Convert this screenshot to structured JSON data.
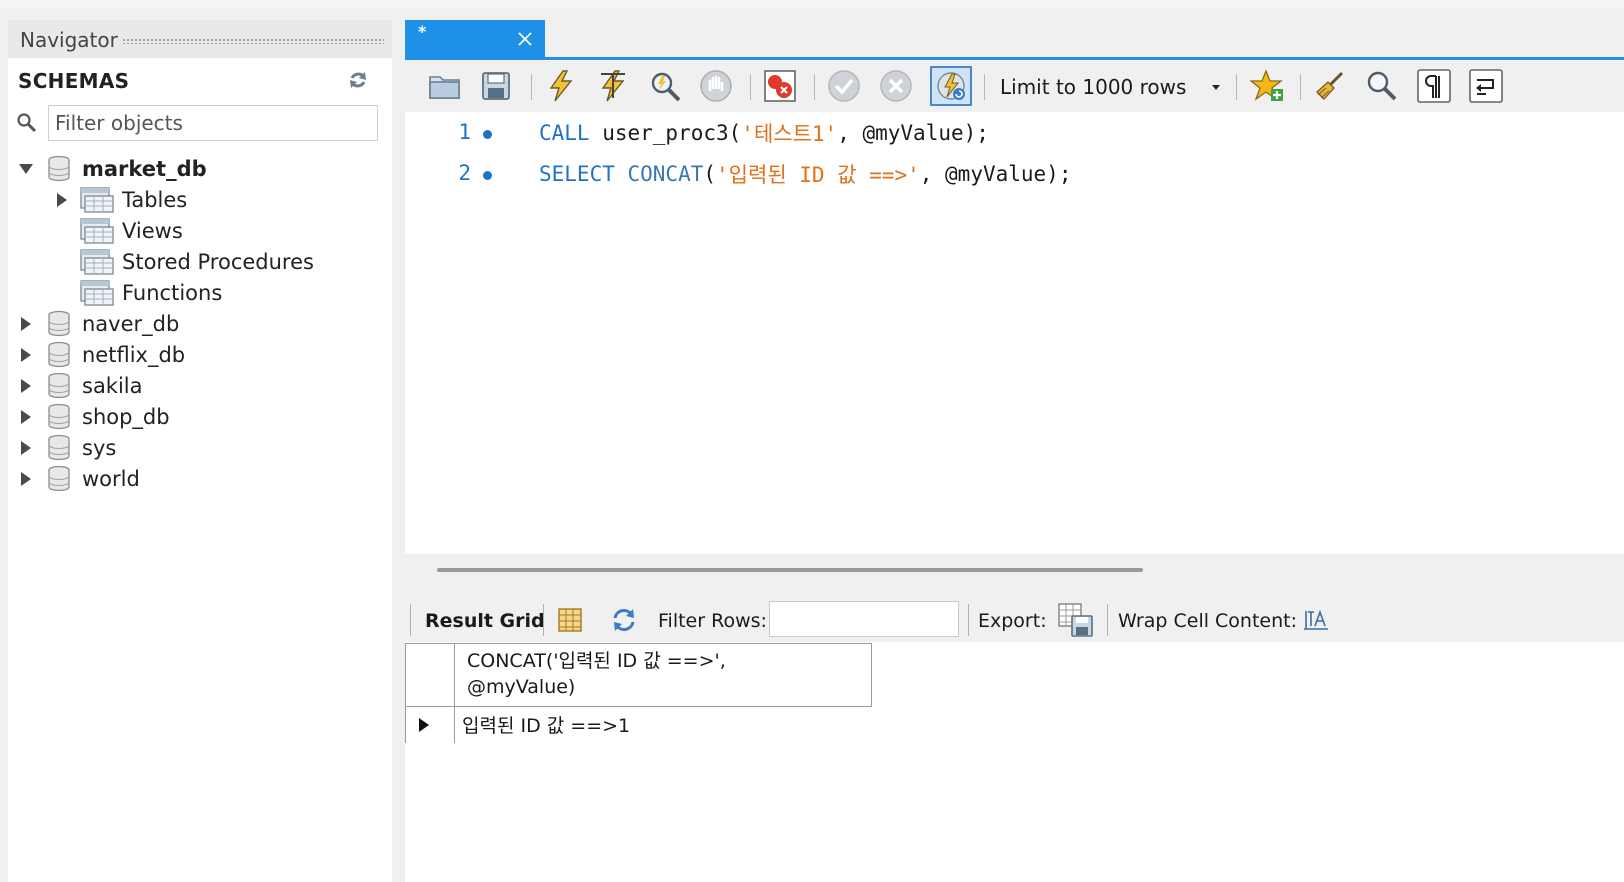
{
  "navigator": {
    "title": "Navigator",
    "schemas_label": "SCHEMAS",
    "filter_placeholder": "Filter objects",
    "databases": [
      {
        "name": "market_db",
        "expanded": true,
        "bold": true,
        "children": [
          "Tables",
          "Views",
          "Stored Procedures",
          "Functions"
        ]
      },
      {
        "name": "naver_db"
      },
      {
        "name": "netflix_db"
      },
      {
        "name": "sakila"
      },
      {
        "name": "shop_db"
      },
      {
        "name": "sys"
      },
      {
        "name": "world"
      }
    ]
  },
  "editor_tab": {
    "label": "*"
  },
  "toolbar": {
    "limit_label": "Limit to 1000 rows",
    "icons": [
      "open-folder-icon",
      "save-icon",
      "execute-icon",
      "execute-current-icon",
      "explain-icon",
      "stop-icon",
      "error-toggle-icon",
      "commit-icon",
      "rollback-icon",
      "autocommit-icon",
      "bookmark-icon",
      "beautify-icon",
      "find-icon",
      "invisible-chars-icon",
      "wrap-icon"
    ]
  },
  "code": {
    "lines": [
      {
        "num": "1",
        "tokens": [
          {
            "t": "CALL",
            "c": "kw"
          },
          {
            "t": " user_proc3(",
            "c": "plain"
          },
          {
            "t": "'테스트1'",
            "c": "str"
          },
          {
            "t": ", @myValue);",
            "c": "plain"
          }
        ]
      },
      {
        "num": "2",
        "tokens": [
          {
            "t": "SELECT",
            "c": "kw"
          },
          {
            "t": " CONCAT",
            "c": "fn"
          },
          {
            "t": "(",
            "c": "plain"
          },
          {
            "t": "'입력된 ID 값 ==>'",
            "c": "str"
          },
          {
            "t": ", @myValue);",
            "c": "plain"
          }
        ]
      }
    ]
  },
  "results": {
    "result_grid_label": "Result Grid",
    "filter_rows_label": "Filter Rows:",
    "export_label": "Export:",
    "wrap_label": "Wrap Cell Content:",
    "column_header_line1": "CONCAT('입력된 ID 값 ==>',",
    "column_header_line2": "@myValue)",
    "row_value": "입력된 ID 값 ==>1"
  },
  "colors": {
    "accent": "#1e90e8",
    "keyword": "#1e73c8",
    "string": "#e0701a"
  }
}
